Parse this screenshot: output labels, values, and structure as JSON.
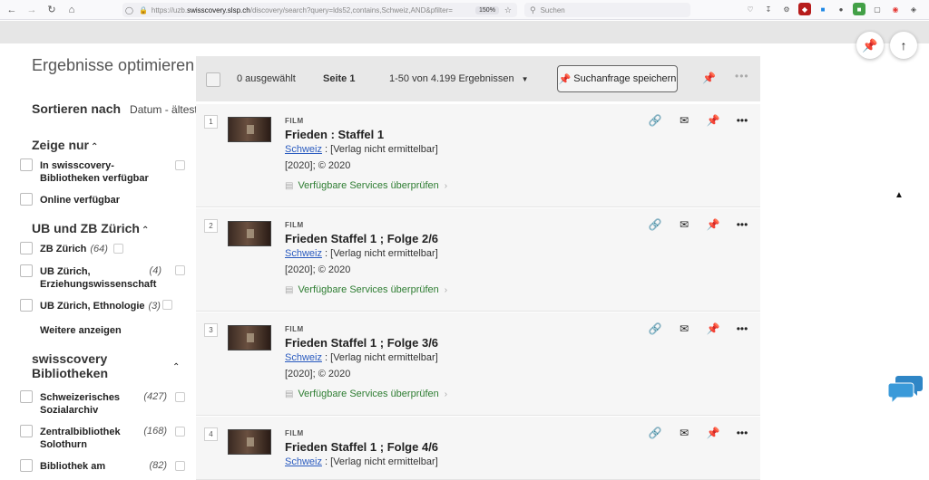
{
  "browser": {
    "url_prefix": "https://uzb.",
    "url_domain": "swisscovery.slsp.ch",
    "url_rest": "/discovery/search?query=lds52,contains,Schweiz,AND&pfilter=",
    "zoom": "150%",
    "search_placeholder": "Suchen"
  },
  "facets": {
    "title": "Ergebnisse optimieren",
    "sort_label": "Sortieren nach",
    "sort_value": "Datum - älteste",
    "group_show": {
      "title": "Zeige nur",
      "items": [
        {
          "label": "In swisscovery-Bibliotheken verfügbar"
        },
        {
          "label": "Online verfügbar"
        }
      ]
    },
    "group_ub": {
      "title": "UB und ZB Zürich",
      "items": [
        {
          "label": "ZB Zürich",
          "count": "(64)"
        },
        {
          "label": "UB Zürich, Erziehungswissenschaft",
          "count": "(4)"
        },
        {
          "label": "UB Zürich, Ethnologie",
          "count": "(3)"
        }
      ],
      "more": "Weitere anzeigen"
    },
    "group_libs": {
      "title": "swisscovery Bibliotheken",
      "items": [
        {
          "label": "Schweizerisches Sozialarchiv",
          "count": "(427)"
        },
        {
          "label": "Zentralbibliothek Solothurn",
          "count": "(168)"
        },
        {
          "label": "Bibliothek am",
          "count": "(82)"
        }
      ]
    }
  },
  "toolbar": {
    "selected": "0 ausgewählt",
    "page": "Seite 1",
    "range": "1-50 von 4.199 Ergebnissen",
    "save_search": "Suchanfrage speichern"
  },
  "results": [
    {
      "num": "1",
      "type": "FILM",
      "title": "Frieden : Staffel 1",
      "place_link": "Schweiz",
      "place_rest": " : [Verlag nicht ermittelbar]",
      "date": "[2020]; © 2020",
      "services": "Verfügbare Services überprüfen"
    },
    {
      "num": "2",
      "type": "FILM",
      "title": "Frieden Staffel 1 ; Folge 2/6",
      "place_link": "Schweiz",
      "place_rest": " : [Verlag nicht ermittelbar]",
      "date": "[2020]; © 2020",
      "services": "Verfügbare Services überprüfen"
    },
    {
      "num": "3",
      "type": "FILM",
      "title": "Frieden Staffel 1 ; Folge 3/6",
      "place_link": "Schweiz",
      "place_rest": " : [Verlag nicht ermittelbar]",
      "date": "[2020]; © 2020",
      "services": "Verfügbare Services überprüfen"
    },
    {
      "num": "4",
      "type": "FILM",
      "title": "Frieden Staffel 1 ; Folge 4/6",
      "place_link": "Schweiz",
      "place_rest": " : [Verlag nicht ermittelbar]",
      "date": "",
      "services": ""
    }
  ],
  "icons": {
    "pin": "pin-icon",
    "link": "link-icon",
    "mail": "mail-icon",
    "more": "more-icon",
    "chat": "chat-icon",
    "arrow_up": "arrow-up-icon"
  }
}
